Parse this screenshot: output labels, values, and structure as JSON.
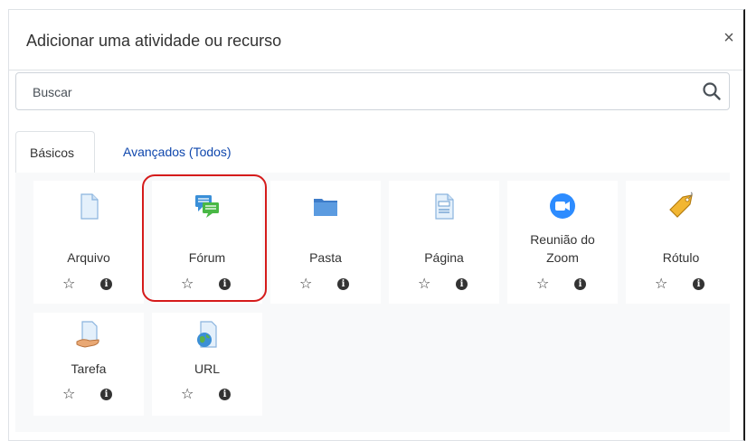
{
  "dialog": {
    "title": "Adicionar uma atividade ou recurso",
    "close_symbol": "×"
  },
  "search": {
    "placeholder": "Buscar",
    "icon": "search-icon"
  },
  "tabs": [
    {
      "label": "Básicos",
      "active": true
    },
    {
      "label": "Avançados (Todos)",
      "active": false
    }
  ],
  "items": [
    {
      "label": "Arquivo",
      "icon": "file-icon"
    },
    {
      "label": "Fórum",
      "icon": "forum-icon"
    },
    {
      "label": "Pasta",
      "icon": "folder-icon"
    },
    {
      "label": "Página",
      "icon": "page-icon"
    },
    {
      "label": "Reunião do Zoom",
      "icon": "zoom-icon"
    },
    {
      "label": "Rótulo",
      "icon": "label-icon"
    },
    {
      "label": "Tarefa",
      "icon": "assignment-icon"
    },
    {
      "label": "URL",
      "icon": "url-icon"
    }
  ],
  "actions": {
    "star_symbol": "☆",
    "info_symbol": "i"
  },
  "colors": {
    "link": "#0f47ad",
    "highlight": "#d51b1b",
    "zoom": "#2d8cff"
  }
}
